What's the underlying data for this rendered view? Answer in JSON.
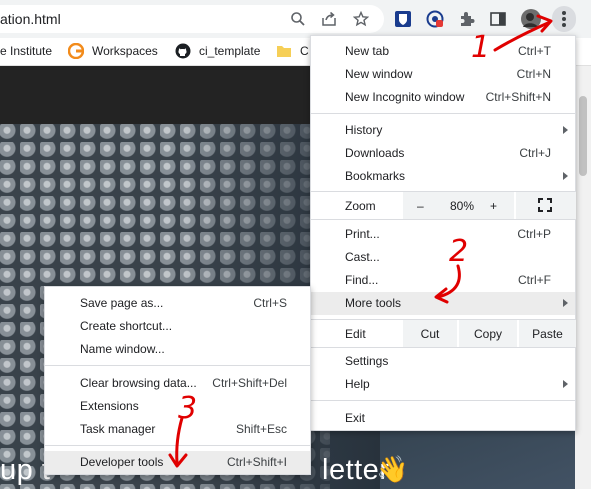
{
  "addressbar": {
    "url_text": "ation.html",
    "omnibox_icons": [
      "zoom-icon",
      "share-icon",
      "star-icon"
    ],
    "extension_icons": [
      "bitwarden-icon",
      "extension-icon",
      "puzzle-icon",
      "sidepanel-icon",
      "profile-avatar"
    ],
    "menu_button": "chrome-menu-icon"
  },
  "bookmarks": [
    {
      "label": "e Institute",
      "icon": "none"
    },
    {
      "label": "Workspaces",
      "icon": "workspaces-icon"
    },
    {
      "label": "ci_template",
      "icon": "github-icon"
    },
    {
      "label": "C",
      "icon": "folder-icon"
    }
  ],
  "page": {
    "hero_text_left": "up t",
    "hero_text_right": "letter",
    "hero_emoji": "👋"
  },
  "main_menu": {
    "new_tab": {
      "label": "New tab",
      "shortcut": "Ctrl+T"
    },
    "new_window": {
      "label": "New window",
      "shortcut": "Ctrl+N"
    },
    "incognito": {
      "label": "New Incognito window",
      "shortcut": "Ctrl+Shift+N"
    },
    "history": {
      "label": "History"
    },
    "downloads": {
      "label": "Downloads",
      "shortcut": "Ctrl+J"
    },
    "bookmarks": {
      "label": "Bookmarks"
    },
    "zoom": {
      "label": "Zoom",
      "minus": "–",
      "value": "80%",
      "plus": "+",
      "fullscreen_icon": "fullscreen-icon"
    },
    "print": {
      "label": "Print...",
      "shortcut": "Ctrl+P"
    },
    "cast": {
      "label": "Cast..."
    },
    "find": {
      "label": "Find...",
      "shortcut": "Ctrl+F"
    },
    "more_tools": {
      "label": "More tools"
    },
    "edit": {
      "label": "Edit",
      "cut": "Cut",
      "copy": "Copy",
      "paste": "Paste"
    },
    "settings": {
      "label": "Settings"
    },
    "help": {
      "label": "Help"
    },
    "exit": {
      "label": "Exit"
    }
  },
  "sub_menu": {
    "save_page": {
      "label": "Save page as...",
      "shortcut": "Ctrl+S"
    },
    "create_shortcut": {
      "label": "Create shortcut..."
    },
    "name_window": {
      "label": "Name window..."
    },
    "clear_data": {
      "label": "Clear browsing data...",
      "shortcut": "Ctrl+Shift+Del"
    },
    "extensions": {
      "label": "Extensions"
    },
    "task_manager": {
      "label": "Task manager",
      "shortcut": "Shift+Esc"
    },
    "dev_tools": {
      "label": "Developer tools",
      "shortcut": "Ctrl+Shift+I"
    }
  },
  "annotations": {
    "step1": "1",
    "step2": "2",
    "step3": "3",
    "color": "#e00000"
  },
  "colors": {
    "menu_highlight": "#ececec",
    "toolbar": "#f1f3f4",
    "page_header": "#232323"
  }
}
